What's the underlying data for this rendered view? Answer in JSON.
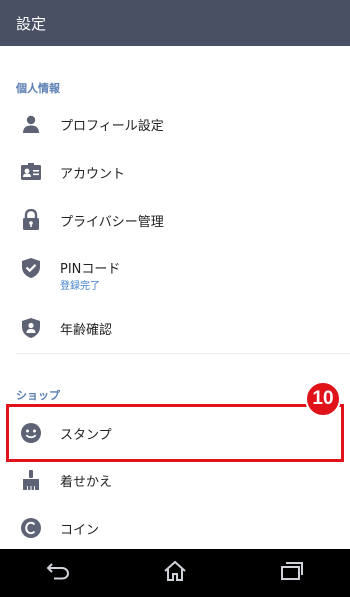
{
  "header": {
    "title": "設定"
  },
  "sections": {
    "personal": {
      "label": "個人情報",
      "items": [
        {
          "label": "プロフィール設定",
          "icon": "person-icon"
        },
        {
          "label": "アカウント",
          "icon": "id-card-icon"
        },
        {
          "label": "プライバシー管理",
          "icon": "lock-icon"
        },
        {
          "label": "PINコード",
          "sublabel": "登録完了",
          "icon": "shield-check-icon"
        },
        {
          "label": "年齢確認",
          "icon": "shield-person-icon"
        }
      ]
    },
    "shop": {
      "label": "ショップ",
      "items": [
        {
          "label": "スタンプ",
          "icon": "smiley-icon"
        },
        {
          "label": "着せかえ",
          "icon": "brush-icon"
        },
        {
          "label": "コイン",
          "icon": "coin-icon"
        }
      ]
    }
  },
  "annotation": {
    "step": "10"
  },
  "colors": {
    "header_bg": "#4a5064",
    "section_label": "#5b7fb3",
    "icon": "#5e6275",
    "highlight": "#e0131b",
    "sublabel": "#3f7ecb"
  },
  "nav": {
    "back_icon": "back-icon",
    "home_icon": "home-icon",
    "recents_icon": "recents-icon"
  }
}
